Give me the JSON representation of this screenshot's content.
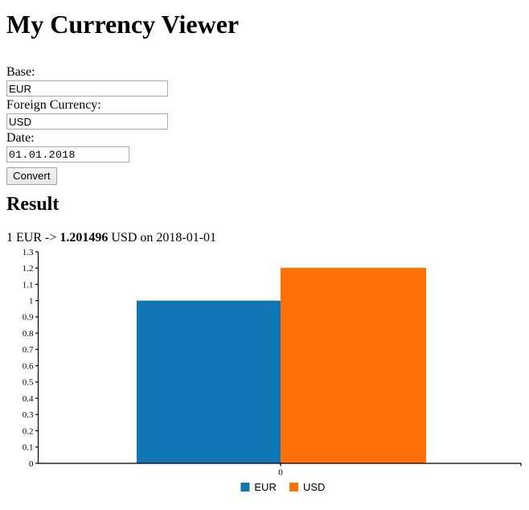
{
  "page": {
    "title": "My Currency Viewer"
  },
  "form": {
    "base": {
      "label": "Base:",
      "value": "EUR",
      "placeholder": "EUR"
    },
    "foreign": {
      "label": "Foreign Currency:",
      "value": "USD",
      "placeholder": "USD"
    },
    "date": {
      "label": "Date:",
      "value": "01.01.2018",
      "placeholder": "dd.mm.yyyy"
    },
    "submit_label": "Convert"
  },
  "result": {
    "heading": "Result",
    "prefix": "1 EUR -> ",
    "rate": "1.201496",
    "suffix": " USD on 2018-01-01"
  },
  "chart_data": {
    "type": "bar",
    "title": "",
    "xlabel": "",
    "ylabel": "",
    "categories": [
      "0"
    ],
    "series": [
      {
        "name": "EUR",
        "values": [
          1.0
        ],
        "color": "#1077b4"
      },
      {
        "name": "USD",
        "values": [
          1.201496
        ],
        "color": "#ff7007"
      }
    ],
    "ylim": [
      0,
      1.3
    ],
    "yticks": [
      "0",
      "0.1",
      "0.2",
      "0.3",
      "0.4",
      "0.5",
      "0.6",
      "0.7",
      "0.8",
      "0.9",
      "1",
      "1.1",
      "1.2",
      "1.3"
    ],
    "xticks": [
      "0"
    ],
    "grid": false,
    "legend": {
      "position": "bottom",
      "entries": [
        {
          "label": "EUR",
          "color": "#1077b4"
        },
        {
          "label": "USD",
          "color": "#ff7007"
        }
      ]
    }
  }
}
